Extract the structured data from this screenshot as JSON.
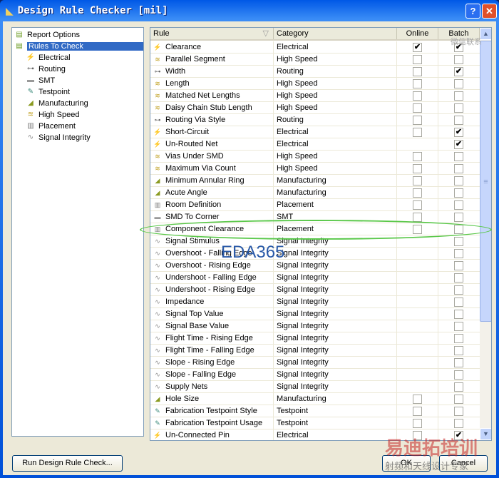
{
  "window": {
    "title": "Design Rule Checker [mil]",
    "help": "?",
    "close": "✕"
  },
  "tree": [
    {
      "label": "Report Options",
      "icon": "folder-icon",
      "level": 0
    },
    {
      "label": "Rules To Check",
      "icon": "folder-icon",
      "level": 0,
      "selected": true
    },
    {
      "label": "Electrical",
      "icon": "electrical-icon",
      "level": 1
    },
    {
      "label": "Routing",
      "icon": "routing-icon",
      "level": 1
    },
    {
      "label": "SMT",
      "icon": "smt-icon",
      "level": 1
    },
    {
      "label": "Testpoint",
      "icon": "testpoint-icon",
      "level": 1
    },
    {
      "label": "Manufacturing",
      "icon": "manufacturing-icon",
      "level": 1
    },
    {
      "label": "High Speed",
      "icon": "high-speed-icon",
      "level": 1
    },
    {
      "label": "Placement",
      "icon": "placement-icon",
      "level": 1
    },
    {
      "label": "Signal Integrity",
      "icon": "signal-integrity-icon",
      "level": 1
    }
  ],
  "table": {
    "headers": {
      "rule": "Rule",
      "category": "Category",
      "online": "Online",
      "batch": "Batch"
    },
    "rows": [
      {
        "rule": "Clearance",
        "category": "Electrical",
        "online": true,
        "batch": true
      },
      {
        "rule": "Parallel Segment",
        "category": "High Speed",
        "online": false,
        "batch": false
      },
      {
        "rule": "Width",
        "category": "Routing",
        "online": false,
        "batch": true
      },
      {
        "rule": "Length",
        "category": "High Speed",
        "online": false,
        "batch": false
      },
      {
        "rule": "Matched Net Lengths",
        "category": "High Speed",
        "online": false,
        "batch": false
      },
      {
        "rule": "Daisy Chain Stub Length",
        "category": "High Speed",
        "online": false,
        "batch": false
      },
      {
        "rule": "Routing Via Style",
        "category": "Routing",
        "online": false,
        "batch": false
      },
      {
        "rule": "Short-Circuit",
        "category": "Electrical",
        "online": false,
        "batch": true
      },
      {
        "rule": "Un-Routed Net",
        "category": "Electrical",
        "online": null,
        "batch": true
      },
      {
        "rule": "Vias Under SMD",
        "category": "High Speed",
        "online": false,
        "batch": false
      },
      {
        "rule": "Maximum Via Count",
        "category": "High Speed",
        "online": false,
        "batch": false
      },
      {
        "rule": "Minimum Annular Ring",
        "category": "Manufacturing",
        "online": false,
        "batch": false
      },
      {
        "rule": "Acute Angle",
        "category": "Manufacturing",
        "online": false,
        "batch": false
      },
      {
        "rule": "Room Definition",
        "category": "Placement",
        "online": false,
        "batch": false
      },
      {
        "rule": "SMD To Corner",
        "category": "SMT",
        "online": false,
        "batch": false
      },
      {
        "rule": "Component Clearance",
        "category": "Placement",
        "online": false,
        "batch": false
      },
      {
        "rule": "Signal Stimulus",
        "category": "Signal Integrity",
        "online": null,
        "batch": false
      },
      {
        "rule": "Overshoot - Falling Edge",
        "category": "Signal Integrity",
        "online": null,
        "batch": false
      },
      {
        "rule": "Overshoot - Rising Edge",
        "category": "Signal Integrity",
        "online": null,
        "batch": false
      },
      {
        "rule": "Undershoot - Falling Edge",
        "category": "Signal Integrity",
        "online": null,
        "batch": false
      },
      {
        "rule": "Undershoot - Rising Edge",
        "category": "Signal Integrity",
        "online": null,
        "batch": false
      },
      {
        "rule": "Impedance",
        "category": "Signal Integrity",
        "online": null,
        "batch": false
      },
      {
        "rule": "Signal Top Value",
        "category": "Signal Integrity",
        "online": null,
        "batch": false
      },
      {
        "rule": "Signal Base Value",
        "category": "Signal Integrity",
        "online": null,
        "batch": false
      },
      {
        "rule": "Flight Time - Rising Edge",
        "category": "Signal Integrity",
        "online": null,
        "batch": false
      },
      {
        "rule": "Flight Time - Falling Edge",
        "category": "Signal Integrity",
        "online": null,
        "batch": false
      },
      {
        "rule": "Slope - Rising Edge",
        "category": "Signal Integrity",
        "online": null,
        "batch": false
      },
      {
        "rule": "Slope - Falling Edge",
        "category": "Signal Integrity",
        "online": null,
        "batch": false
      },
      {
        "rule": "Supply Nets",
        "category": "Signal Integrity",
        "online": null,
        "batch": false
      },
      {
        "rule": "Hole Size",
        "category": "Manufacturing",
        "online": false,
        "batch": false
      },
      {
        "rule": "Fabrication Testpoint Style",
        "category": "Testpoint",
        "online": false,
        "batch": false
      },
      {
        "rule": "Fabrication Testpoint Usage",
        "category": "Testpoint",
        "online": false,
        "batch": false
      },
      {
        "rule": "Un-Connected Pin",
        "category": "Electrical",
        "online": false,
        "batch": true
      }
    ]
  },
  "buttons": {
    "run": "Run Design Rule Check...",
    "ok": "OK",
    "cancel": "Cancel"
  },
  "watermarks": {
    "logo": "EDA365",
    "qr_caption": "微信联系",
    "brand": "易迪拓培训",
    "tagline": "射频和天线设计专家"
  }
}
